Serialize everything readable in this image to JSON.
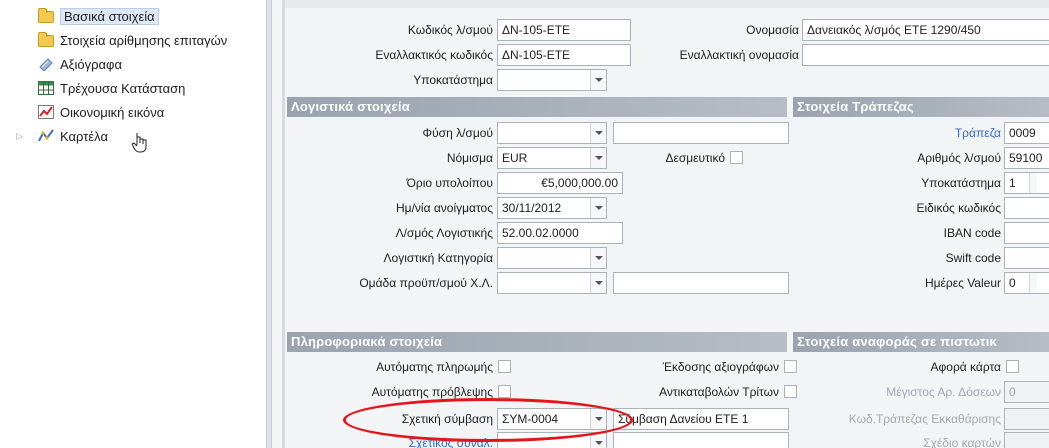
{
  "tree": {
    "items": [
      {
        "label": "Βασικά στοιχεία",
        "icon": "folder-icon",
        "selected": true
      },
      {
        "label": "Στοιχεία αρίθμησης επιταγών",
        "icon": "folder-icon"
      },
      {
        "label": "Αξιόγραφα",
        "icon": "cheque-icon"
      },
      {
        "label": "Τρέχουσα Κατάσταση",
        "icon": "grid-icon"
      },
      {
        "label": "Οικονομική εικόνα",
        "icon": "chart-icon"
      },
      {
        "label": "Καρτέλα",
        "icon": "ledger-icon"
      }
    ]
  },
  "header": {
    "account_code_label": "Κωδικός λ/σμού",
    "account_code_value": "ΔΝ-105-ΕΤΕ",
    "name_label": "Ονομασία",
    "name_value": "Δανειακός λ/σμός ΕΤΕ 1290/450",
    "alt_code_label": "Εναλλακτικός κωδικός",
    "alt_code_value": "ΔΝ-105-ΕΤΕ",
    "alt_name_label": "Εναλλακτική ονομασία",
    "alt_name_value": "",
    "branch_label": "Υποκατάστημα",
    "branch_value": ""
  },
  "accounting": {
    "section_title": "Λογιστικά στοιχεία",
    "nature_label": "Φύση λ/σμού",
    "nature_value": "",
    "nature_extra": "",
    "currency_label": "Νόμισμα",
    "currency_value": "EUR",
    "binding_label": "Δεσμευτικό",
    "balance_limit_label": "Όριο υπολοίπου",
    "balance_limit_value": "€5,000,000.00",
    "open_date_label": "Ημ/νία ανοίγματος",
    "open_date_value": "30/11/2012",
    "gl_account_label": "Λ/σμός Λογιστικής",
    "gl_account_value": "52.00.02.0000",
    "gl_category_label": "Λογιστική Κατηγορία",
    "gl_category_value": "",
    "budget_group_label": "Ομάδα προϋπ/σμού Χ.Λ.",
    "budget_group_value": "",
    "budget_group_extra": ""
  },
  "bank": {
    "section_title": "Στοιχεία Τράπεζας",
    "bank_label": "Τράπεζα",
    "bank_value": "0009",
    "account_no_label": "Αριθμός λ/σμού",
    "account_no_value": "59100",
    "branch_label": "Υποκατάστημα",
    "branch_value": "1",
    "special_code_label": "Ειδικός κωδικός",
    "iban_label": "IBAN code",
    "swift_label": "Swift code",
    "valeur_days_label": "Ημέρες Valeur",
    "valeur_days_value": "0"
  },
  "info": {
    "section_title": "Πληροφοριακά στοιχεία",
    "auto_payment_label": "Αυτόματης πληρωμής",
    "issue_securities_label": "Έκδοσης αξιογράφων",
    "auto_provision_label": "Αυτόματης πρόβλεψης",
    "third_party_label": "Αντικαταβολών Τρίτων",
    "related_contract_label": "Σχετική σύμβαση",
    "related_contract_value": "ΣΥΜ-0004",
    "related_contract_desc": "Σύμβαση Δανείου ΕΤΕ 1",
    "related_partner_label": "Σχετικός συναλ.",
    "related_partner_value": "",
    "related_partner_desc": ""
  },
  "credit": {
    "section_title": "Στοιχεία αναφοράς σε πιστωτικ",
    "card_label": "Αφορά κάρτα",
    "max_installments_label": "Μέγιστος Αρ. Δόσεων",
    "max_installments_value": "0",
    "clearing_bank_label": "Κωδ.Τράπεζας Εκκαθάρισης",
    "card_plan_label": "Σχέδιο καρτών"
  }
}
